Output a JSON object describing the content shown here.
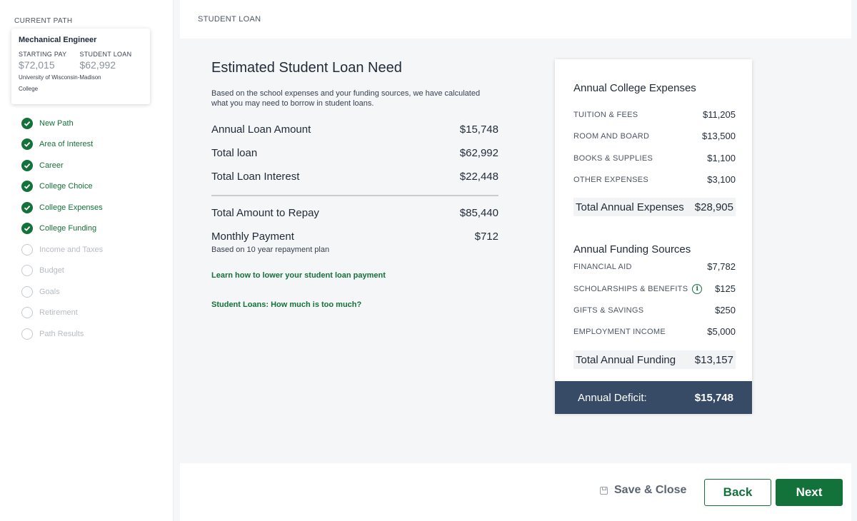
{
  "sidebar": {
    "current_path_label": "CURRENT PATH",
    "card": {
      "career": "Mechanical Engineer",
      "starting_pay_label": "STARTING PAY",
      "starting_pay_value": "$72,015",
      "student_loan_label": "STUDENT LOAN",
      "student_loan_value": "$62,992",
      "school": "University of Wisconsin-Madison",
      "school_type": "College"
    },
    "steps": [
      {
        "label": "New Path",
        "status": "done"
      },
      {
        "label": "Area of Interest",
        "status": "done"
      },
      {
        "label": "Career",
        "status": "done"
      },
      {
        "label": "College Choice",
        "status": "done"
      },
      {
        "label": "College Expenses",
        "status": "done"
      },
      {
        "label": "College Funding",
        "status": "done"
      },
      {
        "label": "Income and Taxes",
        "status": "pending"
      },
      {
        "label": "Budget",
        "status": "pending"
      },
      {
        "label": "Goals",
        "status": "pending"
      },
      {
        "label": "Retirement",
        "status": "pending"
      },
      {
        "label": "Path Results",
        "status": "pending"
      }
    ]
  },
  "header": {
    "breadcrumb": "STUDENT LOAN"
  },
  "estimate": {
    "title": "Estimated Student Loan Need",
    "intro": "Based on the school expenses and your funding sources, we have calculated what you may need to borrow in student loans.",
    "annual_loan_label": "Annual Loan Amount",
    "annual_loan_value": "$15,748",
    "total_loan_label": "Total loan",
    "total_loan_value": "$62,992",
    "total_interest_label": "Total Loan Interest",
    "total_interest_value": "$22,448",
    "total_repay_label": "Total Amount to Repay",
    "total_repay_value": "$85,440",
    "monthly_label": "Monthly Payment",
    "monthly_value": "$712",
    "monthly_note": "Based on 10 year repayment plan",
    "link_lower": "Learn how to lower your student loan payment",
    "link_how_much": "Student Loans: How much is too much?"
  },
  "expenses": {
    "title": "Annual College Expenses",
    "items": [
      {
        "label": "TUITION & FEES",
        "value": "$11,205"
      },
      {
        "label": "ROOM AND BOARD",
        "value": "$13,500"
      },
      {
        "label": "BOOKS & SUPPLIES",
        "value": "$1,100"
      },
      {
        "label": "OTHER EXPENSES",
        "value": "$3,100"
      }
    ],
    "total_label": "Total Annual Expenses",
    "total_value": "$28,905"
  },
  "funding": {
    "title": "Annual Funding Sources",
    "items": [
      {
        "label": "FINANCIAL AID",
        "value": "$7,782"
      },
      {
        "label": "SCHOLARSHIPS & BENEFITS",
        "value": "$125"
      },
      {
        "label": "GIFTS & SAVINGS",
        "value": "$250"
      },
      {
        "label": "EMPLOYMENT INCOME",
        "value": "$5,000"
      }
    ],
    "total_label": "Total Annual Funding",
    "total_value": "$13,157"
  },
  "deficit": {
    "label": "Annual Deficit:",
    "value": "$15,748"
  },
  "footer": {
    "save_close_label": "Save & Close",
    "back_label": "Back",
    "next_label": "Next"
  },
  "colors": {
    "accent_green": "#13713a",
    "deficit_bar": "#374a66"
  }
}
